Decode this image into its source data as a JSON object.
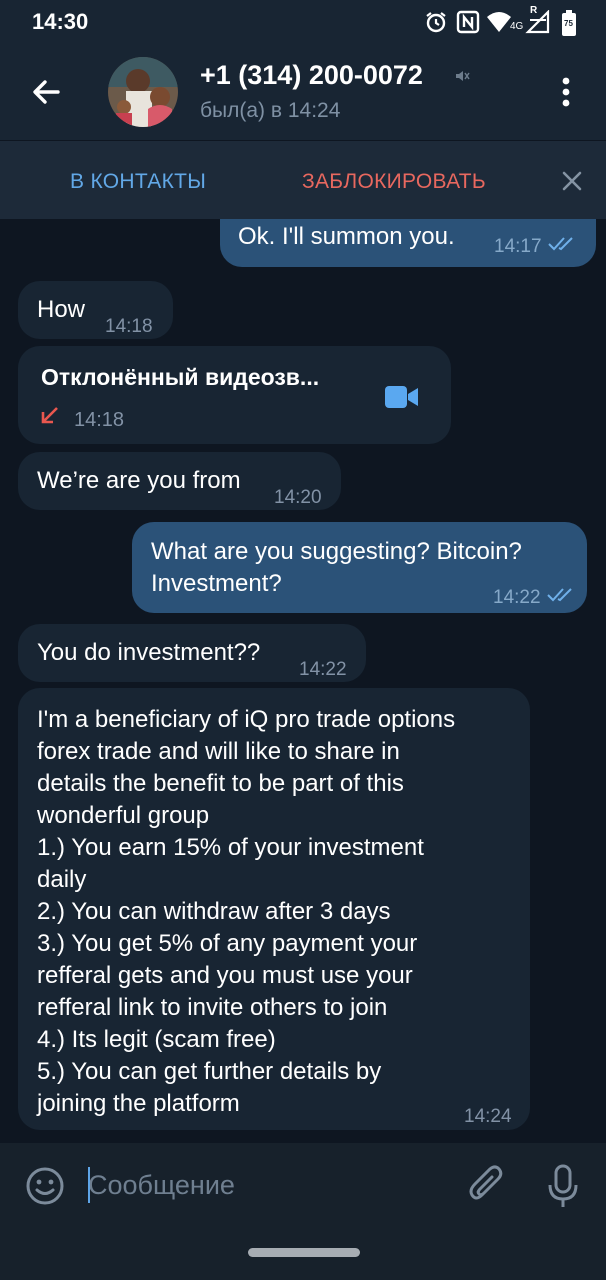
{
  "status_bar": {
    "time": "14:30",
    "network": "4G",
    "signal_badge": "R",
    "battery": "75"
  },
  "header": {
    "contact_name": "+1 (314) 200-0072",
    "last_seen": "был(а) в 14:24"
  },
  "action_bar": {
    "add_contact": "В КОНТАКТЫ",
    "block": "ЗАБЛОКИРОВАТЬ"
  },
  "messages": [
    {
      "dir": "out",
      "text": "Ok. I'll summon you.",
      "time": "14:17",
      "read": true
    },
    {
      "dir": "in",
      "text": "How",
      "time": "14:18"
    },
    {
      "dir": "in",
      "type": "call",
      "text": "Отклонённый видеозв...",
      "time": "14:18"
    },
    {
      "dir": "in",
      "text": "We’re are you from",
      "time": "14:20"
    },
    {
      "dir": "out",
      "text": "What are you suggesting? Bitcoin?\nInvestment?",
      "time": "14:22",
      "read": true
    },
    {
      "dir": "in",
      "text": "You do investment??",
      "time": "14:22"
    },
    {
      "dir": "in",
      "text": "I'm a beneficiary of iQ pro trade options\nforex trade and will like to share in\ndetails the benefit to be part of this\nwonderful group\n1.) You earn 15% of your investment\ndaily\n2.) You can withdraw after 3 days\n3.) You get 5% of any payment your\nrefferal gets and you must use your\nrefferal link to invite others to join\n4.) Its legit (scam free)\n5.) You can get further details by\njoining the platform",
      "time": "14:24"
    }
  ],
  "input": {
    "placeholder": "Сообщение",
    "value": ""
  },
  "colors": {
    "background": "#0e1621",
    "header": "#182533",
    "incoming_bubble": "#182533",
    "outgoing_bubble": "#2b5278",
    "accent": "#62a8e7",
    "danger": "#e8685f"
  },
  "icons": [
    "back-arrow-icon",
    "mute-icon",
    "more-vert-icon",
    "close-icon",
    "double-check-icon",
    "missed-call-arrow-icon",
    "video-camera-icon",
    "emoji-icon",
    "attach-icon",
    "mic-icon",
    "alarm-icon",
    "nfc-icon",
    "wifi-icon",
    "signal-icon",
    "battery-icon"
  ]
}
